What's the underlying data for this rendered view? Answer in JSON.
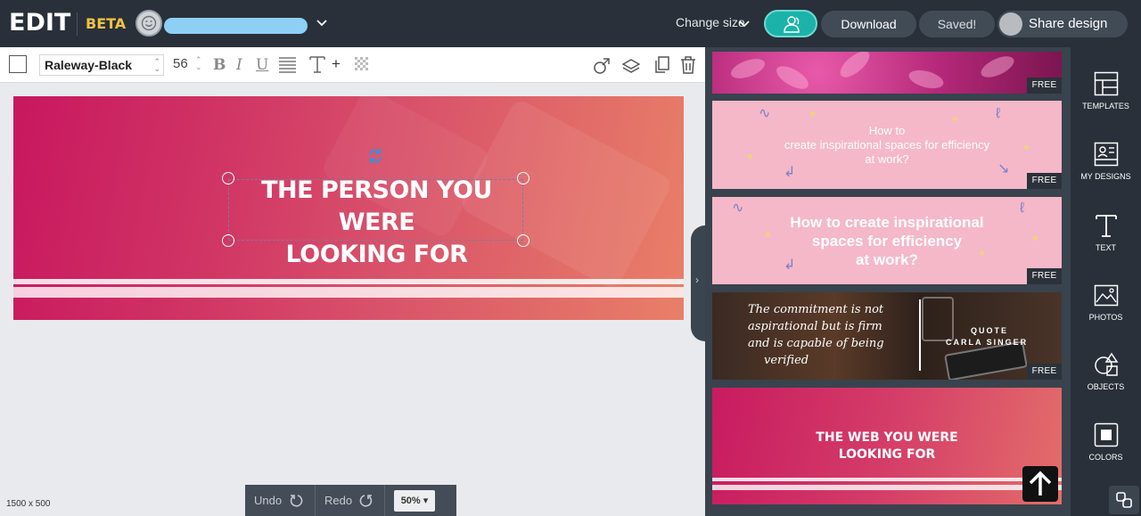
{
  "header": {
    "logo": "EDIT",
    "beta": "BETA",
    "user_name": "",
    "change_size": "Change size",
    "download": "Download",
    "saved": "Saved!",
    "share": "Share design"
  },
  "toolbar": {
    "font_family": "Raleway-Black",
    "font_size": "56",
    "bold": "B",
    "italic": "I",
    "underline": "U",
    "add_text": "+"
  },
  "canvas": {
    "text_line1": "THE PERSON YOU WERE",
    "text_line2": "LOOKING FOR",
    "dimensions": "1500 x 500"
  },
  "history": {
    "undo": "Undo",
    "redo": "Redo",
    "zoom": "50%"
  },
  "templates": {
    "free_label": "FREE",
    "t2_text": [
      "How to",
      "create inspirational spaces for efficiency",
      "at work?"
    ],
    "t3_text": [
      "How to create inspirational",
      "spaces for efficiency",
      "at work?"
    ],
    "t4_quote": [
      "The commitment is not",
      "aspirational but is firm",
      "and is capable of being",
      "verified"
    ],
    "t4_label": "QUOTE",
    "t4_author": "CARLA SINGER",
    "t5_text": [
      "THE WEB YOU WERE",
      "LOOKING FOR"
    ]
  },
  "sidebar": {
    "items": [
      {
        "label": "TEMPLATES",
        "icon": "templates-icon"
      },
      {
        "label": "MY DESIGNS",
        "icon": "my-designs-icon"
      },
      {
        "label": "TEXT",
        "icon": "text-icon"
      },
      {
        "label": "PHOTOS",
        "icon": "photos-icon"
      },
      {
        "label": "OBJECTS",
        "icon": "objects-icon"
      },
      {
        "label": "COLORS",
        "icon": "colors-icon"
      }
    ]
  },
  "colors": {
    "topbar": "#293039",
    "beta": "#f0c244",
    "team_button": "#1bb3a9",
    "panel": "#38434e"
  }
}
